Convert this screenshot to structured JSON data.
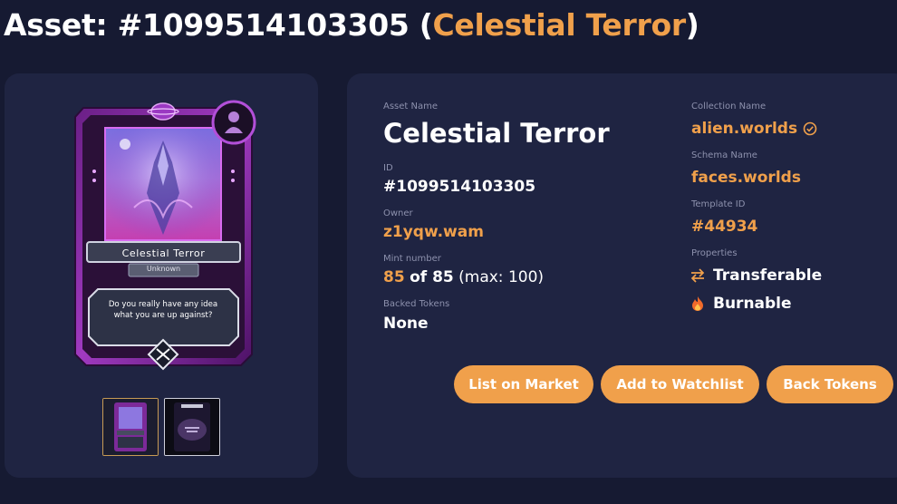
{
  "header": {
    "prefix": "Asset: #1099514103305 (",
    "asset_name": "Celestial Terror",
    "suffix": ")"
  },
  "card": {
    "title": "Celestial Terror",
    "subtitle": "Unknown",
    "description": "Do you really have any idea what you are up against?",
    "thumbnails": [
      "card-front-thumbnail",
      "card-back-thumbnail"
    ]
  },
  "details": {
    "asset_name_label": "Asset Name",
    "asset_name_value": "Celestial Terror",
    "id_label": "ID",
    "id_value": "#1099514103305",
    "owner_label": "Owner",
    "owner_value": "z1yqw.wam",
    "mint_label": "Mint number",
    "mint_number": "85",
    "mint_of": "of 85",
    "mint_max": "(max: 100)",
    "backed_label": "Backed Tokens",
    "backed_value": "None",
    "collection_label": "Collection Name",
    "collection_value": "alien.worlds",
    "schema_label": "Schema Name",
    "schema_value": "faces.worlds",
    "template_label": "Template ID",
    "template_value": "#44934",
    "properties_label": "Properties",
    "properties": [
      {
        "icon": "transfer-arrows-icon",
        "label": "Transferable"
      },
      {
        "icon": "flame-icon",
        "label": "Burnable"
      }
    ]
  },
  "actions": {
    "list_label": "List on Market",
    "watchlist_label": "Add to Watchlist",
    "back_label": "Back Tokens"
  },
  "colors": {
    "background": "#161a32",
    "panel": "#1f2442",
    "accent": "#f0a04b",
    "label": "#8d91ad"
  }
}
